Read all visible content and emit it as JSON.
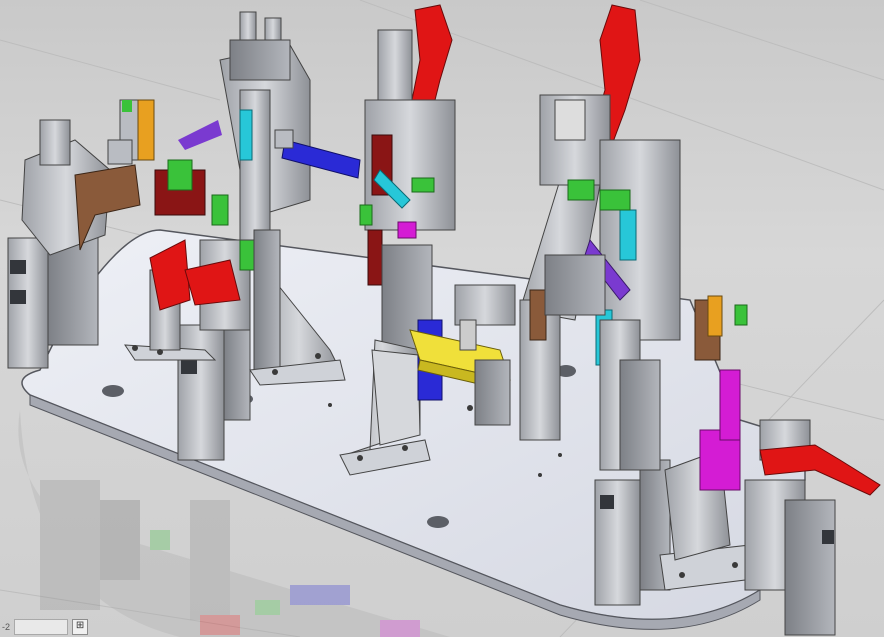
{
  "viewport": {
    "description_colors": {
      "background": "#d0d0d0",
      "plate": "#e4e4ea",
      "steel": "#b9bcc2",
      "red": "#e01515",
      "green": "#3ac23a",
      "blue": "#2a2ad6",
      "yellow": "#f0e03a",
      "magenta": "#d41cd4",
      "cyan": "#27c7d8",
      "brown": "#8a5a3a",
      "darkred": "#8a1515",
      "orange": "#e8a020"
    }
  },
  "statusbar": {
    "left_label": "-2",
    "field_value": "",
    "corner_icon": "view-triad-icon"
  }
}
